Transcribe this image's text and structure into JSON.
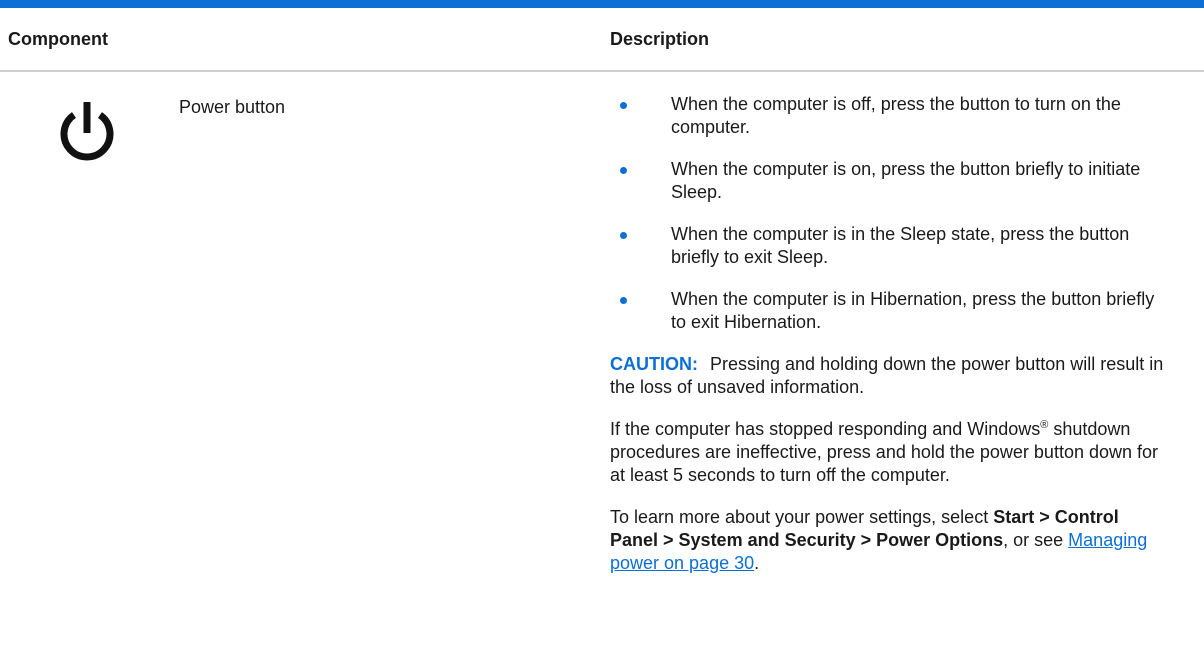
{
  "colors": {
    "accent": "#0b6fd6",
    "text": "#1a1a1a",
    "rule": "#cfcfcf"
  },
  "table": {
    "headers": {
      "component": "Component",
      "description": "Description"
    },
    "row": {
      "icon": "power-icon",
      "component": "Power button",
      "bullets": [
        "When the computer is off, press the button to turn on the computer.",
        "When the computer is on, press the button briefly to initiate Sleep.",
        "When the computer is in the Sleep state, press the button briefly to exit Sleep.",
        "When the computer is in Hibernation, press the button briefly to exit Hibernation."
      ],
      "caution": {
        "label": "CAUTION:",
        "text": "Pressing and holding down the power button will result in the loss of unsaved information."
      },
      "paragraph1": {
        "before": "If the computer has stopped responding and Windows",
        "mark": "®",
        "after": " shutdown procedures are ineffective, press and hold the power button down for at least 5 seconds to turn off the computer."
      },
      "paragraph2": {
        "before": "To learn more about your power settings, select ",
        "path": "Start > Control Panel > System and Security > Power Options",
        "middle": ", or see ",
        "link": "Managing power on page 30",
        "end": "."
      }
    }
  }
}
